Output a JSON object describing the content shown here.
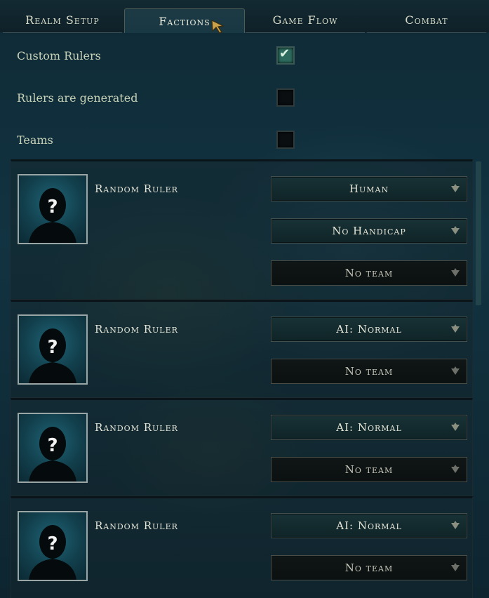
{
  "tabs": [
    {
      "label": "Realm Setup"
    },
    {
      "label": "Factions"
    },
    {
      "label": "Game Flow"
    },
    {
      "label": "Combat"
    }
  ],
  "options": {
    "custom_rulers": {
      "label": "Custom Rulers",
      "checked": true
    },
    "rulers_generated": {
      "label": "Rulers are generated",
      "checked": false
    },
    "teams": {
      "label": "Teams",
      "checked": false
    }
  },
  "rulers": [
    {
      "name": "Random Ruler",
      "control": "Human",
      "handicap": "No Handicap",
      "team": "No team"
    },
    {
      "name": "Random Ruler",
      "control": "AI: Normal",
      "team": "No team"
    },
    {
      "name": "Random Ruler",
      "control": "AI: Normal",
      "team": "No team"
    },
    {
      "name": "Random Ruler",
      "control": "AI: Normal",
      "team": "No team"
    }
  ],
  "icons": {
    "unknown_avatar": "question-silhouette-icon",
    "dropdown_arrow": "chevron-down-icon",
    "check": "checkmark-icon",
    "cursor": "mouse-pointer-icon"
  },
  "colors": {
    "check_on": "#2c6b5e",
    "text": "#e3e4d6"
  }
}
